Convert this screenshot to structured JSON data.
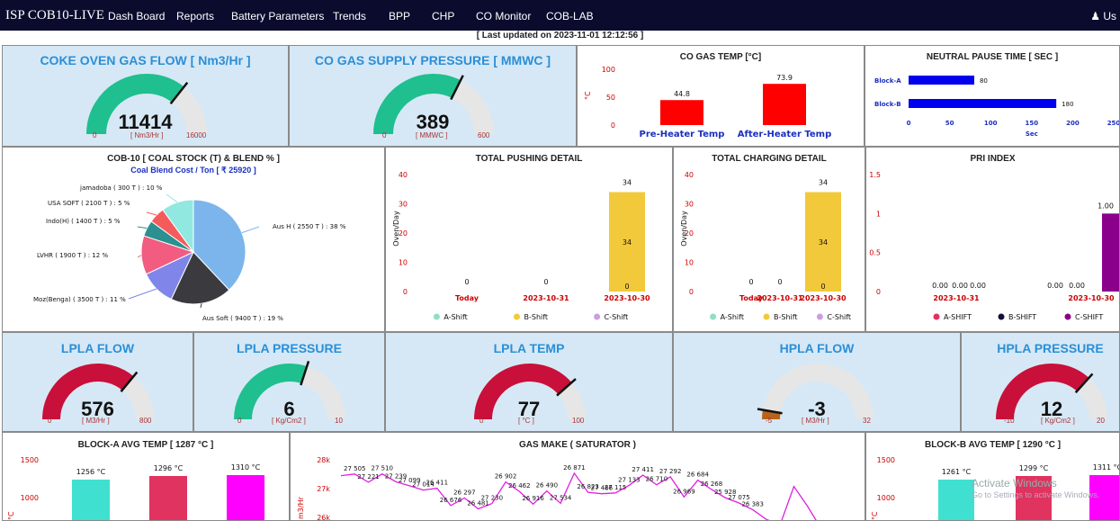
{
  "nav": {
    "brand": "ISP COB10-LIVE",
    "items": [
      "Dash Board",
      "Reports",
      "Battery Parameters",
      "Trends",
      "BPP",
      "CHP",
      "CO Monitor",
      "COB-LAB"
    ],
    "user": "Us"
  },
  "updated": "[ Last updated on 2023-11-01 12:12:56 ]",
  "gauges": {
    "coke_oven_gas_flow": {
      "title": "COKE OVEN GAS FLOW [ Nm3/Hr ]",
      "value": "11414",
      "min": "0",
      "max": "16000",
      "unit": "[ Nm3/Hr ]",
      "level": 0.713,
      "color": "#1fbf8f"
    },
    "co_gas_supply_pressure": {
      "title": "CO GAS SUPPLY PRESSURE [ MMWC ]",
      "value": "389",
      "min": "0",
      "max": "600",
      "unit": "[ MMWC ]",
      "level": 0.648,
      "color": "#1fbf8f"
    },
    "lpla_flow": {
      "title": "LPLA FLOW",
      "value": "576",
      "min": "0",
      "max": "800",
      "unit": "[ M3/Hr ]",
      "level": 0.72,
      "color": "#c8103a"
    },
    "lpla_pressure": {
      "title": "LPLA PRESSURE",
      "value": "6",
      "min": "0",
      "max": "10",
      "unit": "[ Kg/Cm2 ]",
      "level": 0.6,
      "color": "#1fbf8f"
    },
    "lpla_temp": {
      "title": "LPLA TEMP",
      "value": "77",
      "min": "0",
      "max": "100",
      "unit": "[ °C ]",
      "level": 0.77,
      "color": "#c8103a"
    },
    "hpla_flow": {
      "title": "HPLA FLOW",
      "value": "-3",
      "min": "-5",
      "max": "32",
      "unit": "[ M3/Hr ]",
      "level": 0.054,
      "color": "#b8621b"
    },
    "hpla_pressure": {
      "title": "HPLA PRESSURE",
      "value": "12",
      "min": "-10",
      "max": "20",
      "unit": "[ Kg/Cm2 ]",
      "level": 0.733,
      "color": "#c8103a"
    }
  },
  "co_gas_temp": {
    "title": "CO GAS TEMP [°C]",
    "ylabel": "°C",
    "ticks": [
      "100",
      "50",
      "0"
    ],
    "categories": [
      "Pre-Heater Temp",
      "After-Heater Temp"
    ],
    "values": [
      44.8,
      73.9
    ],
    "labels": [
      "44.8",
      "73.9"
    ]
  },
  "neutral_pause": {
    "title": "NEUTRAL PAUSE TIME [ SEC ]",
    "categories": [
      "Block-A",
      "Block-B"
    ],
    "values": [
      80,
      180
    ],
    "ticks": [
      "0",
      "50",
      "100",
      "150",
      "200",
      "250"
    ],
    "xlabel": "Sec"
  },
  "coal_stock": {
    "title": "COB-10 [ COAL STOCK (T) & BLEND % ]",
    "subtitle": "Coal Blend Cost / Ton [ ₹ 25920 ]",
    "slices": [
      {
        "label": "Aus H ( 2550 T ) : 38 %",
        "pct": 38,
        "color": "#7cb5ec"
      },
      {
        "label": "Aus Soft ( 9400 T ) : 19 %",
        "pct": 19,
        "color": "#3b3b3f"
      },
      {
        "label": "Moz(Benga) ( 3500 T ) : 11 %",
        "pct": 11,
        "color": "#8085e9"
      },
      {
        "label": "LVHR ( 1900 T ) : 12 %",
        "pct": 12,
        "color": "#f15c80"
      },
      {
        "label": "Indo(H) ( 1400 T ) : 5 %",
        "pct": 5,
        "color": "#2b908f"
      },
      {
        "label": "USA SOFT ( 2100 T ) : 5 %",
        "pct": 5,
        "color": "#f45b5b"
      },
      {
        "label": "jamadoba ( 300 T ) : 10 %",
        "pct": 10,
        "color": "#91e8e1"
      }
    ]
  },
  "pushing": {
    "title": "TOTAL PUSHING DETAIL",
    "ylabel": "Oven/Day",
    "ticks": [
      "40",
      "30",
      "20",
      "10",
      "0"
    ],
    "categories": [
      "Today",
      "2023-10-31",
      "2023-10-30"
    ],
    "values": [
      0,
      0,
      34
    ],
    "top_labels": [
      "0",
      "0",
      "34"
    ],
    "inner_labels": [
      "",
      "",
      "34"
    ],
    "legend": [
      "A-Shift",
      "B-Shift",
      "C-Shift"
    ]
  },
  "charging": {
    "title": "TOTAL CHARGING DETAIL",
    "ylabel": "Oven/Day",
    "ticks": [
      "40",
      "30",
      "20",
      "10",
      "0"
    ],
    "categories": [
      "Today",
      "2023-10-31",
      "2023-10-30"
    ],
    "values": [
      0,
      0,
      34
    ],
    "top_labels": [
      "0",
      "0",
      "34"
    ],
    "inner_labels": [
      "",
      "",
      "34"
    ],
    "legend": [
      "A-Shift",
      "B-Shift",
      "C-Shift"
    ]
  },
  "pri": {
    "title": "PRI INDEX",
    "ticks": [
      "1.5",
      "1",
      "0.5",
      "0"
    ],
    "categories": [
      "2023-10-31",
      "2023-10-30"
    ],
    "labels": [
      "0.00",
      "0.00",
      "0.00",
      "0.00",
      "0.00",
      "1.00"
    ],
    "legend": [
      "A-SHIFT",
      "B-SHIFT",
      "C-SHIFT"
    ]
  },
  "block_a": {
    "title": "BLOCK-A AVG TEMP [ 1287 °C ]",
    "ticks": [
      "1500",
      "1000"
    ],
    "labels": [
      "1256 °C",
      "1296 °C",
      "1310 °C"
    ],
    "colors": [
      "#40e0d0",
      "#e0335f",
      "#ff00ff"
    ]
  },
  "block_b": {
    "title": "BLOCK-B AVG TEMP [ 1290 °C ]",
    "ticks": [
      "1500",
      "1000"
    ],
    "labels": [
      "1261 °C",
      "1299 °C",
      "1311 °C"
    ],
    "colors": [
      "#40e0d0",
      "#e0335f",
      "#ff00ff"
    ]
  },
  "gas_make": {
    "title": "GAS MAKE ( SATURATOR )",
    "ylabel": "m3/Hr",
    "ticks": [
      "28k",
      "27k",
      "26k"
    ],
    "points": [
      [
        0,
        27.45
      ],
      [
        1,
        27.505
      ],
      [
        2,
        27.221
      ],
      [
        3,
        27.51
      ],
      [
        4,
        27.239
      ],
      [
        5,
        27.099
      ],
      [
        6,
        26.95
      ],
      [
        7,
        27.014
      ],
      [
        8,
        26.411
      ],
      [
        9,
        26.676
      ],
      [
        10,
        26.297
      ],
      [
        11,
        26.481
      ],
      [
        12,
        27.23
      ],
      [
        13,
        26.902
      ],
      [
        14,
        26.462
      ],
      [
        15,
        26.916
      ],
      [
        16,
        26.49
      ],
      [
        17,
        27.534
      ],
      [
        18,
        26.871
      ],
      [
        19,
        26.823
      ],
      [
        20,
        26.85
      ],
      [
        21,
        27.115
      ],
      [
        22,
        27.466
      ],
      [
        23,
        27.133
      ],
      [
        24,
        27.411
      ],
      [
        25,
        26.71
      ],
      [
        26,
        27.292
      ],
      [
        27,
        26.969
      ],
      [
        28,
        26.684
      ],
      [
        29,
        26.5
      ],
      [
        30,
        26.268
      ],
      [
        31,
        25.928
      ],
      [
        32,
        25.75
      ],
      [
        33,
        27.075
      ],
      [
        34,
        26.383
      ],
      [
        35,
        25.6
      ]
    ],
    "labels": [
      "27 505",
      "27 221",
      "27 510",
      "27 239",
      "27 099",
      "27 014",
      "26 411",
      "26 676",
      "26 297",
      "26 481",
      "27 230",
      "26 902",
      "26 462",
      "26 916",
      "26 490",
      "27 534",
      "26 871",
      "26 823",
      "27 466",
      "27 115",
      "27 133",
      "27 411",
      "26 710",
      "27 292",
      "26 969",
      "26 684",
      "26 268",
      "25 928",
      "27 075",
      "26 383"
    ]
  },
  "watermark": {
    "line1": "Activate Windows",
    "line2": "Go to Settings to activate Windows."
  }
}
